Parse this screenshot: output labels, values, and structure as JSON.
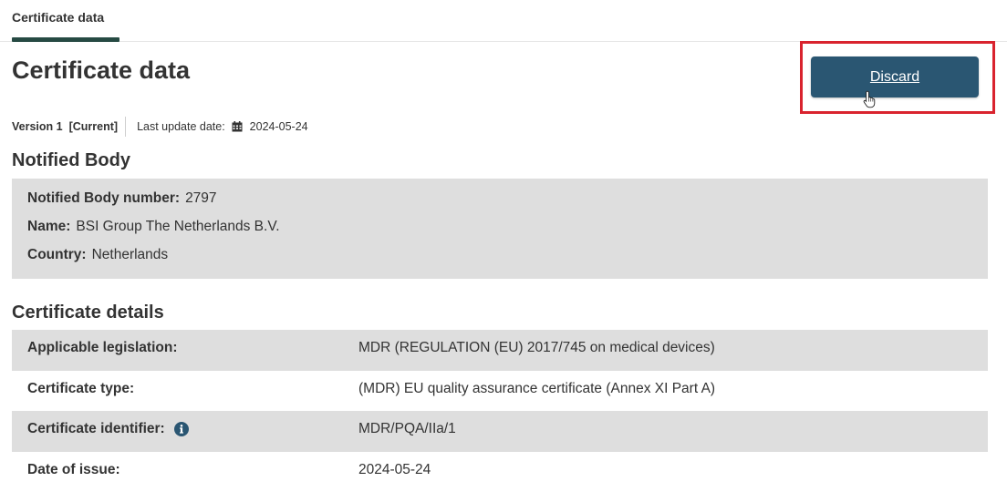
{
  "tabs": [
    {
      "label": "Certificate data",
      "active": true
    }
  ],
  "header": {
    "title": "Certificate data",
    "discard_label": "Discard"
  },
  "version": {
    "label": "Version 1",
    "status": "[Current]",
    "last_update_label": "Last update date:",
    "last_update_date": "2024-05-24"
  },
  "notified_body": {
    "title": "Notified Body",
    "number_label": "Notified Body number:",
    "number": "2797",
    "name_label": "Name:",
    "name": "BSI Group The Netherlands B.V.",
    "country_label": "Country:",
    "country": "Netherlands"
  },
  "certificate_details": {
    "title": "Certificate details",
    "rows": [
      {
        "label": "Applicable legislation:",
        "value": "MDR (REGULATION (EU) 2017/745 on medical devices)"
      },
      {
        "label": "Certificate type:",
        "value": "(MDR) EU quality assurance certificate (Annex XI Part A)"
      },
      {
        "label": "Certificate identifier:",
        "value": "MDR/PQA/IIa/1"
      },
      {
        "label": "Date of issue:",
        "value": "2024-05-24"
      }
    ]
  },
  "colors": {
    "tab_underline": "#264a43",
    "button_bg": "#2a5672",
    "highlight": "#d9232e",
    "panel_bg": "#dedede",
    "info_icon": "#2a5672"
  },
  "icons": {
    "calendar": "calendar-icon",
    "info": "info-icon",
    "cursor": "hand-cursor-icon"
  }
}
